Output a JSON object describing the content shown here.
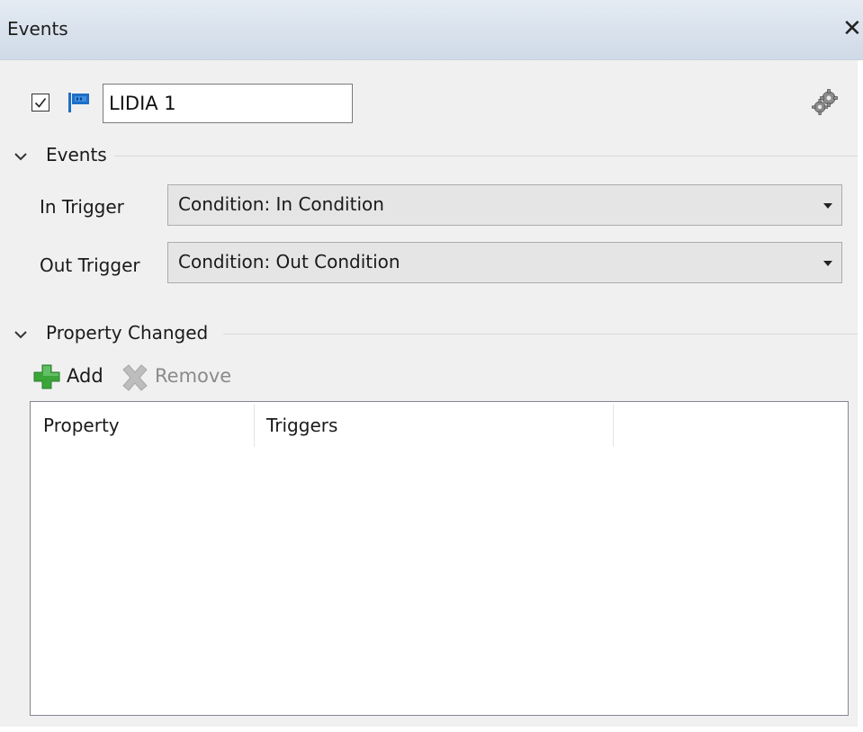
{
  "window": {
    "title": "Events",
    "close_glyph": "✕"
  },
  "header": {
    "enabled_checked": true,
    "name_value": "LIDIA 1",
    "icons": [
      "checkbox",
      "flag-icon",
      "gear-icon"
    ]
  },
  "events_section": {
    "title": "Events",
    "expanded": true,
    "fields": [
      {
        "label": "In Trigger",
        "value": "Condition: In Condition"
      },
      {
        "label": "Out Trigger",
        "value": "Condition: Out Condition"
      }
    ]
  },
  "property_section": {
    "title": "Property Changed",
    "expanded": true,
    "toolbar": {
      "add_label": "Add",
      "remove_label": "Remove",
      "remove_enabled": false
    },
    "table": {
      "columns": [
        "Property",
        "Triggers",
        ""
      ],
      "rows": []
    }
  },
  "colors": {
    "title_bar": "#cfdae7",
    "panel_bg": "#f0f0f0",
    "add_green": "#3aa63a",
    "flag_blue": "#1f6fc5",
    "disabled_text": "#8a8a8a"
  }
}
